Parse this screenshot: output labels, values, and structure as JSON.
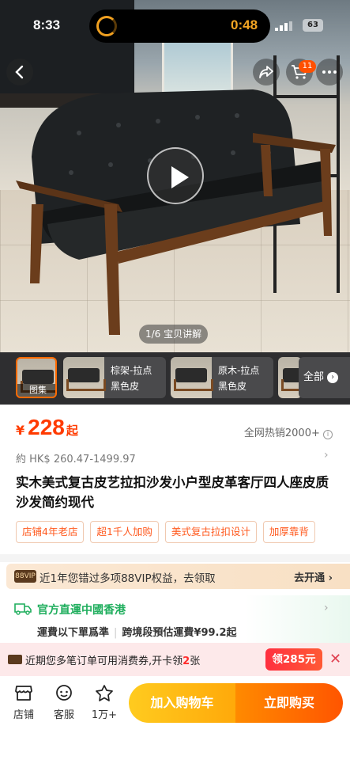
{
  "status_bar": {
    "time": "8:33",
    "timer": "0:48",
    "battery": "63"
  },
  "nav": {
    "cart_count": "11"
  },
  "gallery": {
    "pager": "1/6 宝贝讲解"
  },
  "thumbs": {
    "items": [
      {
        "caption": "图集"
      },
      {
        "line1": "棕架-拉点",
        "line2": "黑色皮"
      },
      {
        "line1": "原木-拉点",
        "line2": "黑色皮"
      }
    ],
    "all_label": "全部"
  },
  "product": {
    "currency": "¥",
    "price": "228",
    "price_suffix": "起",
    "sales": "全网热销2000+",
    "hkd_range": "約 HK$ 260.47-1499.97",
    "title": "实木美式复古皮艺拉扣沙发小户型皮革客厅四人座皮质沙发简约现代",
    "tags": [
      "店铺4年老店",
      "超1千人加购",
      "美式复古拉扣设计",
      "加厚靠背"
    ]
  },
  "vip": {
    "badge": "88VIP",
    "text": "近1年您错过多项88VIP权益，去领取",
    "action": "去开通"
  },
  "shipping": {
    "title": "官方直運中國香港",
    "sub1": "運費以下單爲準",
    "sub2": "跨境段預估運費¥99.2起"
  },
  "coupon": {
    "text_before": "近期您多笔订单可用消费券,开卡领",
    "count": "2",
    "text_after": "张",
    "button": "领285元"
  },
  "bottom_bar": {
    "store": "店铺",
    "service": "客服",
    "favorites": "1万+",
    "add_cart": "加入购物车",
    "buy_now": "立即购买"
  }
}
